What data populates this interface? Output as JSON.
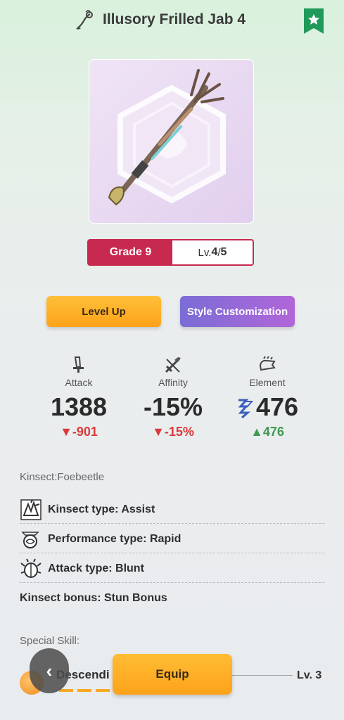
{
  "header": {
    "title": "Illusory Frilled Jab 4",
    "weapon_icon": "insect-glaive-icon",
    "favorite_icon": "star-bookmark-icon"
  },
  "weapon": {
    "image": "insect-glaive-weapon-image"
  },
  "grade": {
    "label": "Grade 9",
    "level_prefix": "Lv.",
    "level_current": "4",
    "level_separator": "/",
    "level_max": "5"
  },
  "actions": {
    "level_up": "Level Up",
    "style_customization": "Style Customization",
    "equip": "Equip",
    "back": "‹"
  },
  "stats": [
    {
      "label": "Attack",
      "value": "1388",
      "diff": "▼-901",
      "trend": "down",
      "icon": "sword-icon"
    },
    {
      "label": "Affinity",
      "value": "-15%",
      "diff": "▼-15%",
      "trend": "down",
      "icon": "crossed-swords-icon"
    },
    {
      "label": "Element",
      "value": "476",
      "diff": "▲476",
      "trend": "up",
      "icon": "element-hand-icon",
      "element_icon": "thunder-element-icon"
    }
  ],
  "kinsect": {
    "title": "Kinsect:Foebeetle",
    "rows": [
      {
        "text": "Kinsect type: Assist",
        "icon": "kinsect-assist-icon"
      },
      {
        "text": "Performance type: Rapid",
        "icon": "kinsect-rapid-icon"
      },
      {
        "text": "Attack type: Blunt",
        "icon": "kinsect-blunt-icon"
      },
      {
        "text": "Kinsect bonus: Stun Bonus",
        "icon": ""
      }
    ]
  },
  "special_skill": {
    "title": "Special Skill:",
    "name": "Descendi",
    "level": "Lv. 3",
    "icon": "skill-orb-icon"
  },
  "colors": {
    "grade": "#c8294f",
    "accent": "#fca21a",
    "style_gradient_start": "#7b6dd6",
    "style_gradient_end": "#b166d8",
    "negative": "#d93a3a",
    "positive": "#3e9a52",
    "favorite": "#1f9a5a"
  }
}
